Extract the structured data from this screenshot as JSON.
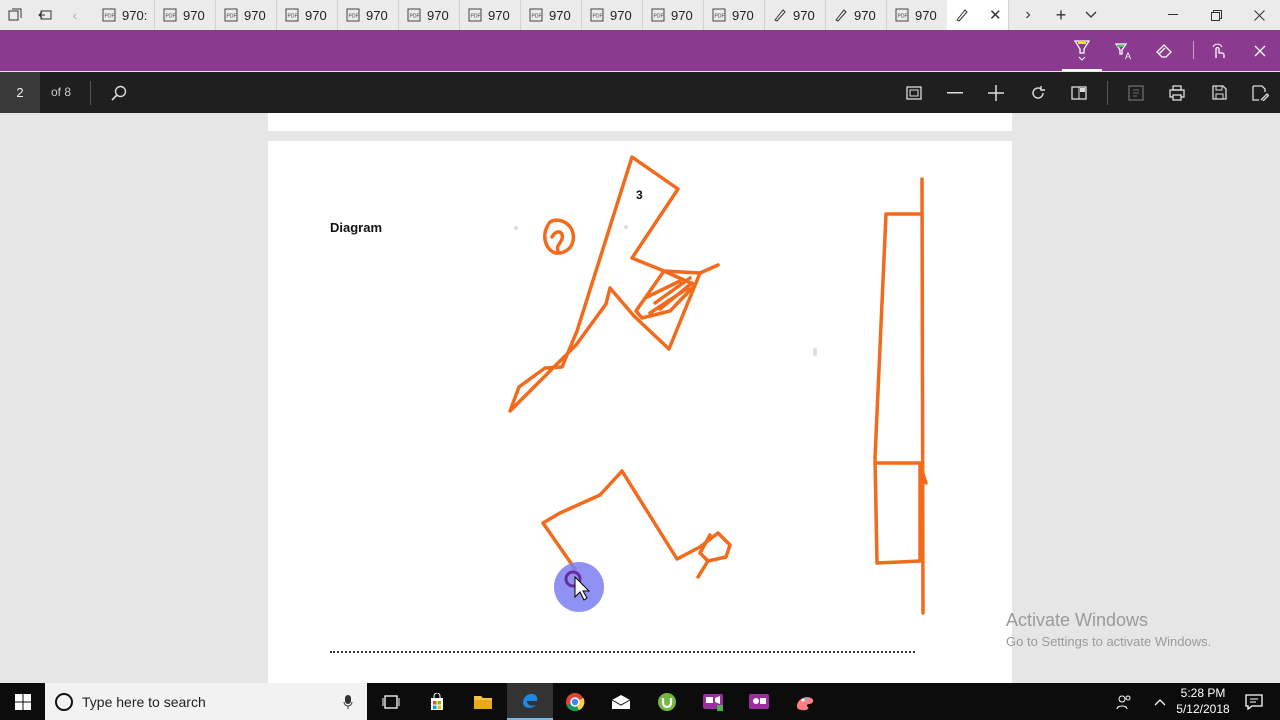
{
  "tabs": {
    "items": [
      {
        "label": "970:",
        "icon": "pdf-icon"
      },
      {
        "label": "970",
        "icon": "pdf-icon"
      },
      {
        "label": "970",
        "icon": "pdf-icon"
      },
      {
        "label": "970",
        "icon": "pdf-icon"
      },
      {
        "label": "970",
        "icon": "pdf-icon"
      },
      {
        "label": "970",
        "icon": "pdf-icon"
      },
      {
        "label": "970",
        "icon": "pdf-icon"
      },
      {
        "label": "970",
        "icon": "pdf-icon"
      },
      {
        "label": "970",
        "icon": "pdf-icon"
      },
      {
        "label": "970",
        "icon": "pdf-icon"
      },
      {
        "label": "970",
        "icon": "pdf-icon"
      },
      {
        "label": "970",
        "icon": "ink-pen-icon"
      },
      {
        "label": "970",
        "icon": "ink-pen-icon"
      },
      {
        "label": "970",
        "icon": "pdf-icon"
      }
    ]
  },
  "pdf_toolbar": {
    "page_number": "2",
    "page_total": "of 8"
  },
  "document": {
    "heading": "Diagram",
    "annotation": "3"
  },
  "watermark": {
    "line1": "Activate Windows",
    "line2": "Go to Settings to activate Windows."
  },
  "taskbar": {
    "search_placeholder": "Type here to search",
    "time": "5:28 PM",
    "date": "5/12/2018"
  },
  "colors": {
    "ink": "#f26a1b",
    "ink_toolbar": "#8b3b8f",
    "pointer": "#7b7ff0"
  }
}
